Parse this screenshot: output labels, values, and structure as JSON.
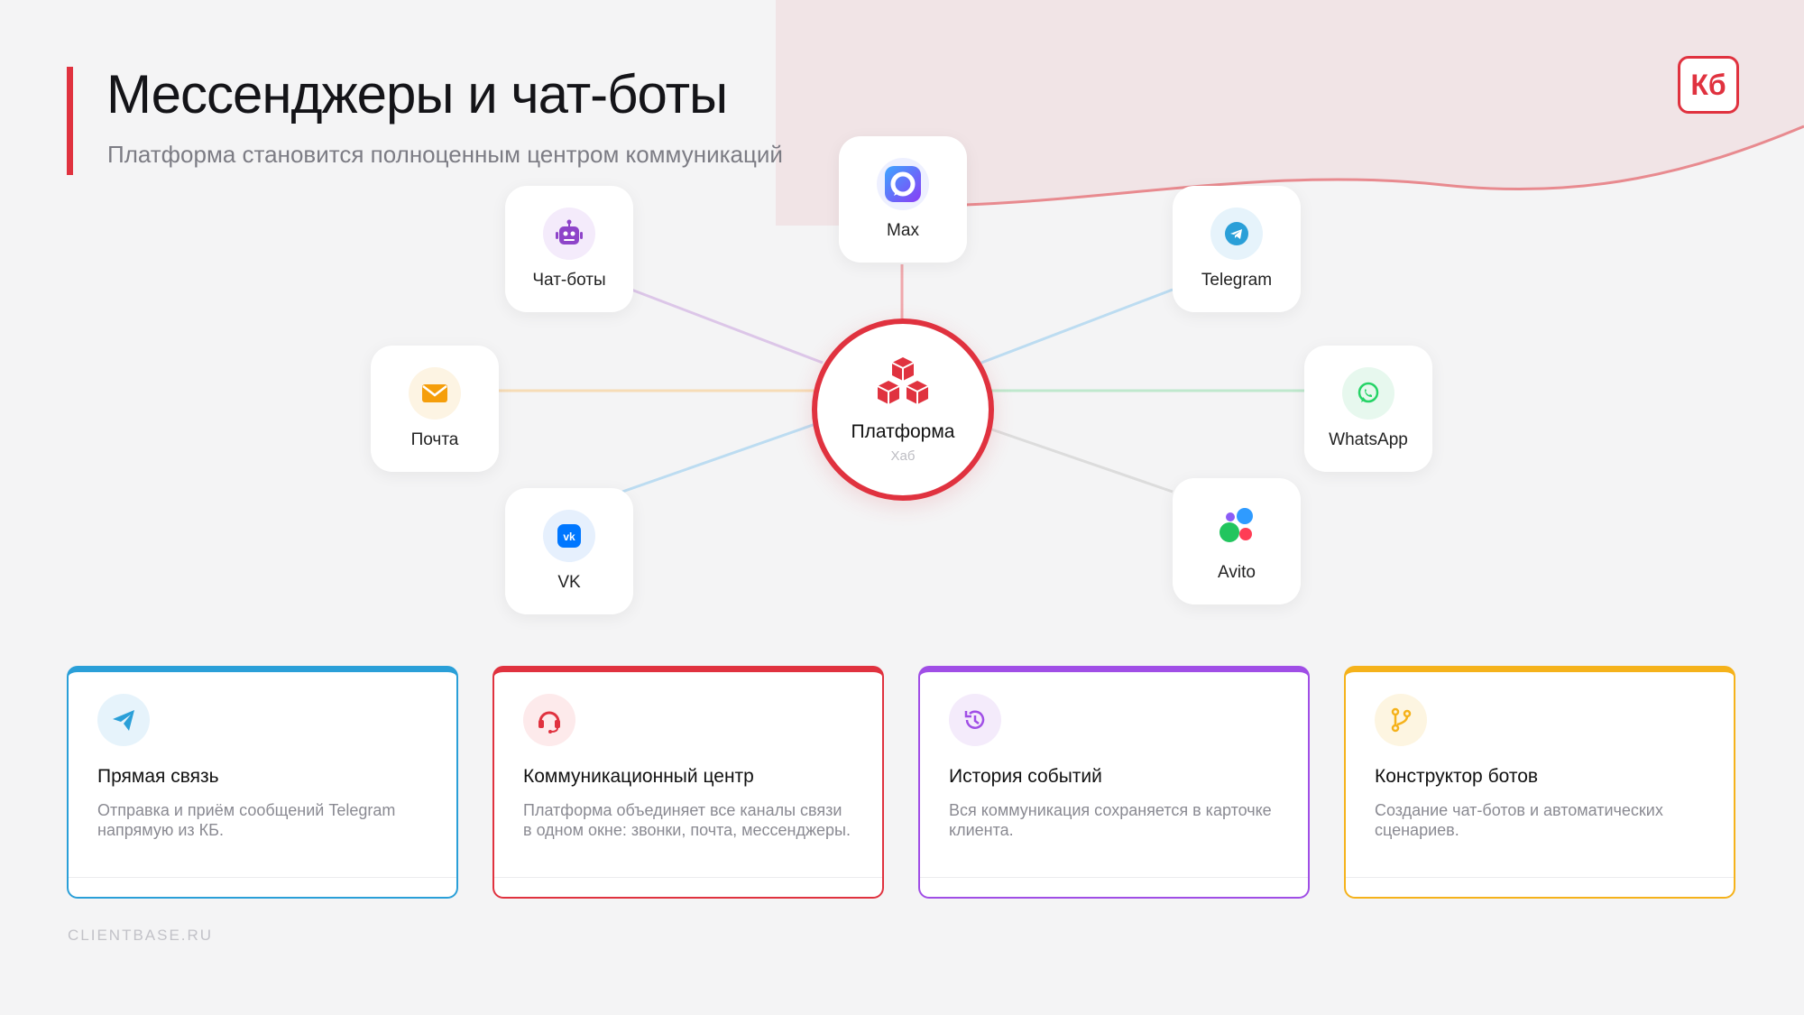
{
  "header": {
    "title": "Мессенджеры и чат-боты",
    "subtitle": "Платформа становится полноценным центром коммуникаций",
    "logo": "Кб"
  },
  "colors": {
    "accent": "#e0323f",
    "telegram": "#2a9fd8",
    "purple": "#a04ee6",
    "yellow": "#f5b21b",
    "whatsapp": "#25d366",
    "vk": "#0077ff"
  },
  "hub": {
    "name": "Платформа",
    "sub": "Хаб",
    "icon": "cubes-icon"
  },
  "channels": [
    {
      "label": "Max",
      "icon": "max-icon"
    },
    {
      "label": "Telegram",
      "icon": "telegram-icon"
    },
    {
      "label": "WhatsApp",
      "icon": "whatsapp-icon"
    },
    {
      "label": "Avito",
      "icon": "avito-icon"
    },
    {
      "label": "VK",
      "icon": "vk-icon"
    },
    {
      "label": "Почта",
      "icon": "mail-icon"
    },
    {
      "label": "Чат-боты",
      "icon": "robot-icon"
    }
  ],
  "features": [
    {
      "title": "Прямая связь",
      "desc": "Отправка и приём сообщений Telegram напрямую из КБ.",
      "icon": "paper-plane-icon",
      "color": "#2a9fd8"
    },
    {
      "title": "Коммуникационный центр",
      "desc": "Платформа объединяет все каналы связи в одном окне: звонки, почта, мессенджеры.",
      "icon": "headset-icon",
      "color": "#e0323f"
    },
    {
      "title": "История событий",
      "desc": "Вся коммуникация сохраняется в карточке клиента.",
      "icon": "history-icon",
      "color": "#a04ee6"
    },
    {
      "title": "Конструктор ботов",
      "desc": "Создание чат-ботов и автоматических сценариев.",
      "icon": "branch-icon",
      "color": "#f5b21b"
    }
  ],
  "footer": {
    "text": "CLIENTBASE.RU"
  }
}
